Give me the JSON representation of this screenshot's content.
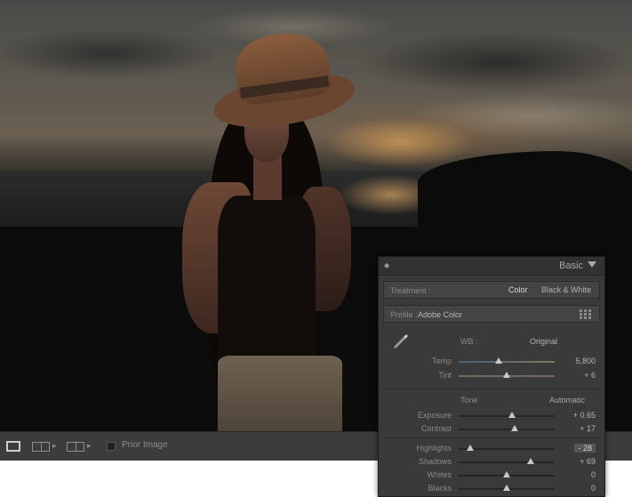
{
  "toolbar": {
    "view_loupe_icon": "loupe-view-icon",
    "view_grid_icon": "grid-view-icon",
    "prior_image_label": "Prior Image"
  },
  "panel": {
    "title": "Basic",
    "treatment": {
      "label": "Treatment :",
      "options": [
        "Color",
        "Black & White"
      ],
      "selected": "Color"
    },
    "profile": {
      "label": "Profile :",
      "value": "Adobe Color"
    },
    "white_balance": {
      "label": "WB :",
      "value": "Original",
      "sliders": [
        {
          "label": "Temp",
          "value": "5,800",
          "level": 0.42
        },
        {
          "label": "Tint",
          "value": "+ 6",
          "level": 0.5
        }
      ]
    },
    "tone": {
      "label": "Tone",
      "auto_label": "Automatic",
      "sliders": [
        {
          "label": "Exposure",
          "value": "+ 0.65",
          "level": 0.56
        },
        {
          "label": "Contrast",
          "value": "+ 17",
          "level": 0.58
        },
        {
          "label": "Highlights",
          "value": "- 28",
          "level": 0.12
        },
        {
          "label": "Shadows",
          "value": "+ 69",
          "level": 0.75
        },
        {
          "label": "Whites",
          "value": "0",
          "level": 0.5
        },
        {
          "label": "Blacks",
          "value": "0",
          "level": 0.5
        }
      ]
    }
  }
}
